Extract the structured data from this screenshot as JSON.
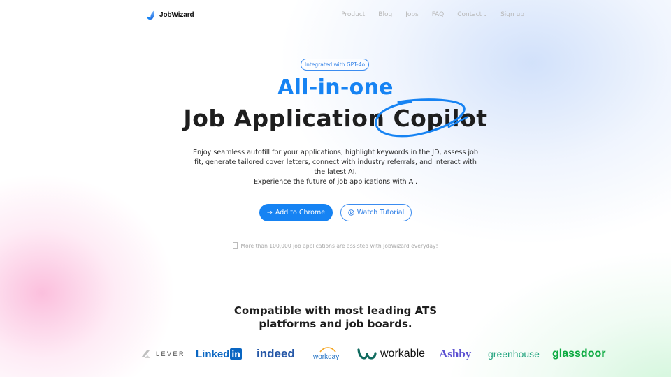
{
  "nav": {
    "brand": "JobWizard",
    "links": [
      {
        "label": "Product"
      },
      {
        "label": "Blog"
      },
      {
        "label": "Jobs"
      },
      {
        "label": "FAQ"
      },
      {
        "label": "Contact",
        "has_dropdown": true
      },
      {
        "label": "Sign up"
      }
    ]
  },
  "hero": {
    "badge": "Integrated with GPT-4o",
    "title_line1": "All-in-one",
    "title_line2_prefix": "Job Application ",
    "title_line2_highlight": "Copilot",
    "description_line1": "Enjoy seamless autofill for your applications, highlight keywords in the JD, assess job fit, generate tailored cover letters, connect with industry referrals, and interact with the latest AI.",
    "description_line2": "Experience the future of job applications with AI.",
    "primary_button": {
      "icon": "arrow-right-icon",
      "label": "Add to Chrome"
    },
    "secondary_button": {
      "icon": "play-circle-icon",
      "label": "Watch Tutorial"
    },
    "note": "More than 100,000 job applications are assisted with JobWizard everyday!"
  },
  "compatibility": {
    "heading_line1": "Compatible with most leading ATS",
    "heading_line2": "platforms and job boards.",
    "brands": [
      {
        "name": "LEVER"
      },
      {
        "name": "Linked",
        "suffix": "in"
      },
      {
        "name": "indeed"
      },
      {
        "name": "workday"
      },
      {
        "name": "workable"
      },
      {
        "name": "Ashby"
      },
      {
        "name": "greenhouse"
      },
      {
        "name": "glassdoor"
      }
    ]
  },
  "colors": {
    "accent": "#1683f3",
    "text_dark": "#1e1e1e",
    "nav_link": "#b8b8b8"
  }
}
